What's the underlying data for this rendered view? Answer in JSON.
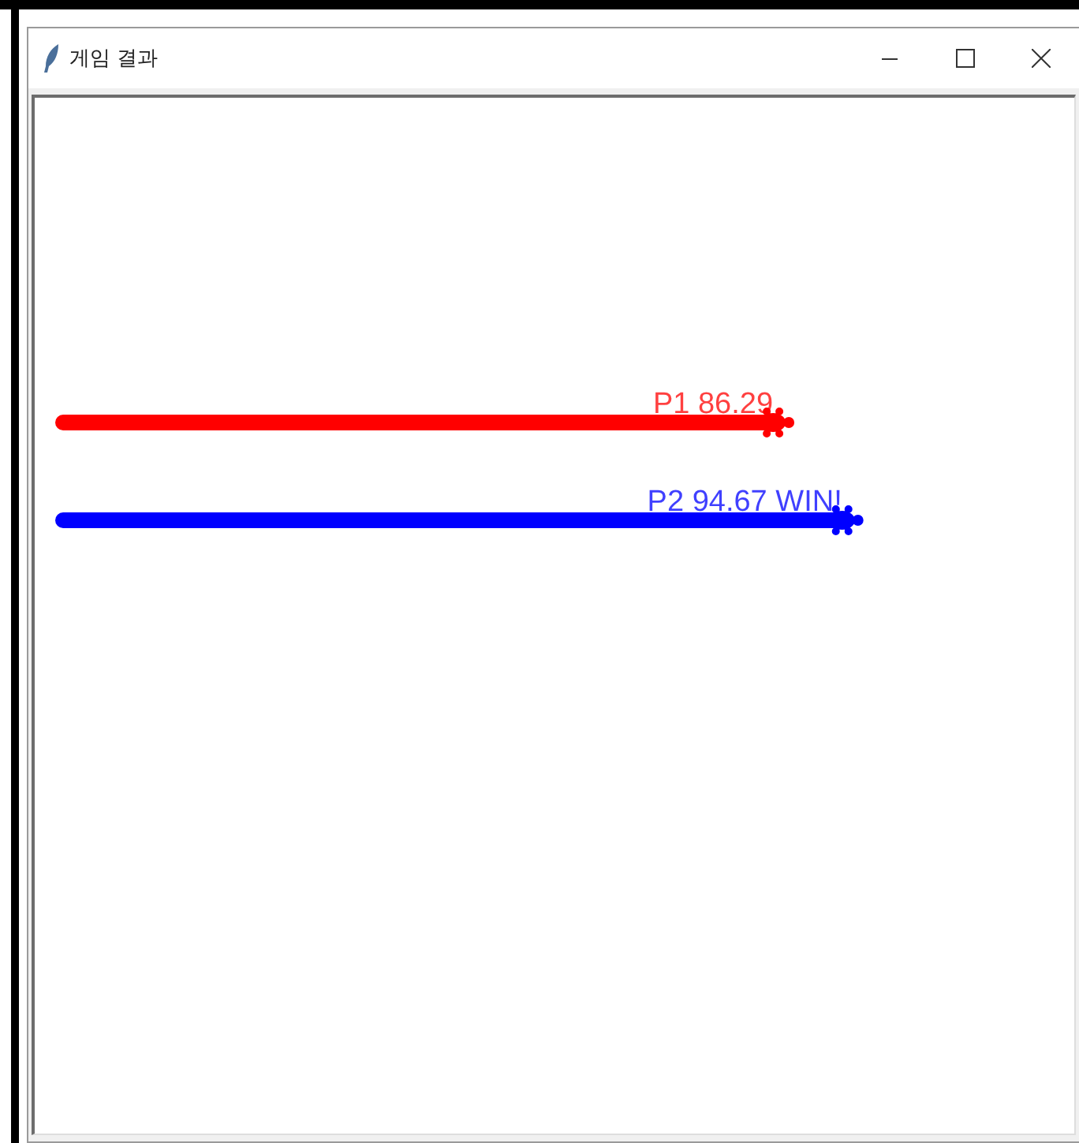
{
  "window": {
    "title": "게임 결과"
  },
  "players": [
    {
      "label": "P1 86.29",
      "color": "#ff0000"
    },
    {
      "label": "P2 94.67 WIN!",
      "color": "#0000ff"
    }
  ]
}
